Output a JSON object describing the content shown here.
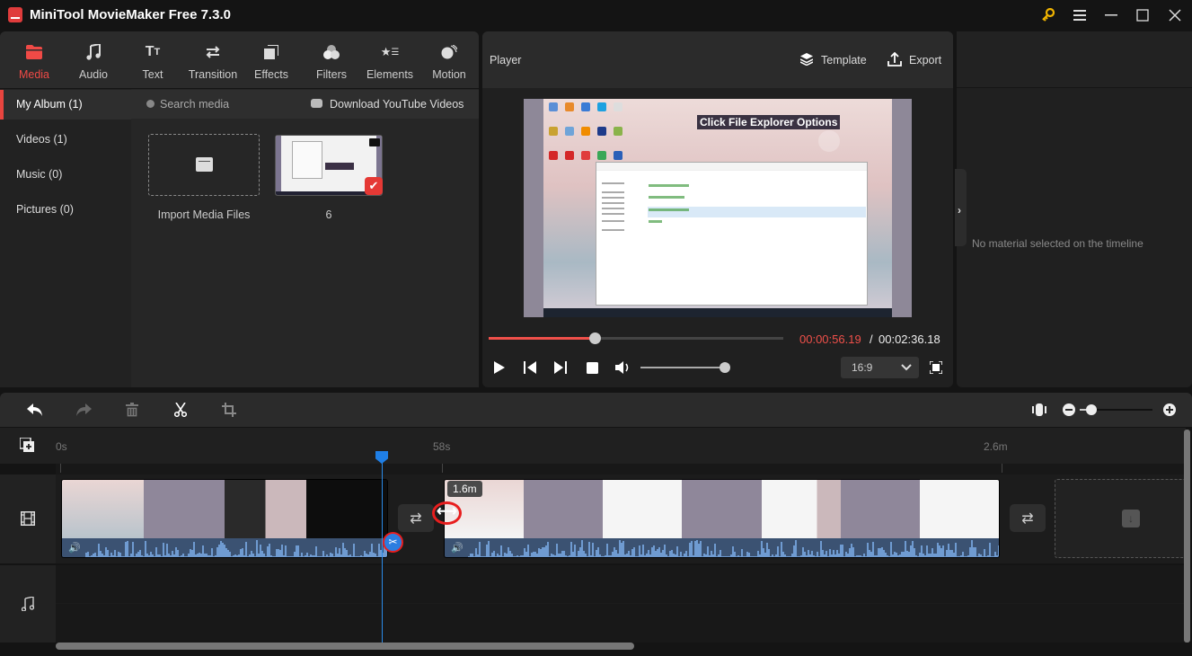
{
  "app": {
    "title": "MiniTool MovieMaker Free 7.3.0"
  },
  "window_controls": {
    "key": "activate-key",
    "menu": "menu",
    "minimize": "minimize",
    "maximize": "maximize",
    "close": "close"
  },
  "tabs": [
    {
      "label": "Media",
      "icon": "folder-icon",
      "active": true
    },
    {
      "label": "Audio",
      "icon": "music-note-icon"
    },
    {
      "label": "Text",
      "icon": "text-icon"
    },
    {
      "label": "Transition",
      "icon": "swap-arrows-icon"
    },
    {
      "label": "Effects",
      "icon": "layers-icon"
    },
    {
      "label": "Filters",
      "icon": "circles-icon"
    },
    {
      "label": "Elements",
      "icon": "star-list-icon"
    },
    {
      "label": "Motion",
      "icon": "motion-ball-icon"
    }
  ],
  "album": {
    "items": [
      {
        "label": "My Album (1)",
        "active": true
      },
      {
        "label": "Videos (1)"
      },
      {
        "label": "Music (0)"
      },
      {
        "label": "Pictures (0)"
      }
    ]
  },
  "media": {
    "search_placeholder": "Search media",
    "download_label": "Download YouTube Videos",
    "import_label": "Import Media Files",
    "clips": [
      {
        "label": "6",
        "type": "video",
        "selected": true
      }
    ]
  },
  "player": {
    "title": "Player",
    "template_label": "Template",
    "export_label": "Export",
    "preview_caption": "Click File Explorer Options",
    "current_time": "00:00:56.19",
    "separator": "/",
    "total_time": "00:02:36.18",
    "progress_fraction": 0.36,
    "volume_fraction": 1.0,
    "aspect_ratio": "16:9"
  },
  "properties": {
    "empty_message": "No material selected on the timeline"
  },
  "timeline": {
    "ruler_labels": [
      "0s",
      "58s",
      "2.6m"
    ],
    "duration_tooltip": "1.6m",
    "zoom_fraction": 0.1,
    "tools": [
      "undo",
      "redo",
      "delete",
      "split",
      "crop"
    ]
  },
  "colors": {
    "accent": "#f04a46",
    "playhead": "#2b8be8",
    "waveform": "#6f9bd1"
  }
}
